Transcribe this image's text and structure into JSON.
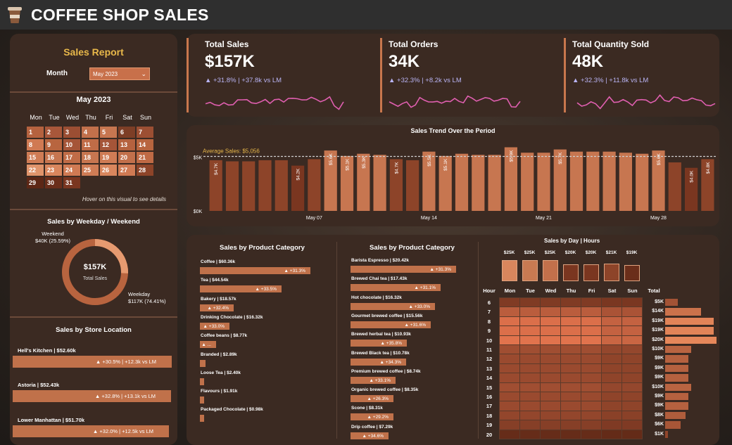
{
  "header": {
    "title": "COFFEE SHOP SALES",
    "icon": "coffee-cup-icon"
  },
  "colors": {
    "accent": "#c8774d",
    "gold": "#e8b84a",
    "panel": "#3b2a22",
    "sparkline": "#e05fb0",
    "change": "#b9b4f4"
  },
  "filters": {
    "title": "Sales Report",
    "month_label": "Month",
    "month_value": "May 2023"
  },
  "calendar": {
    "title": "May 2023",
    "weekdays": [
      "Mon",
      "Tue",
      "Wed",
      "Thu",
      "Fri",
      "Sat",
      "Sun"
    ],
    "days": [
      "1",
      "2",
      "3",
      "4",
      "5",
      "6",
      "7",
      "8",
      "9",
      "10",
      "11",
      "12",
      "13",
      "14",
      "15",
      "16",
      "17",
      "18",
      "19",
      "20",
      "21",
      "22",
      "23",
      "24",
      "25",
      "26",
      "27",
      "28",
      "29",
      "30",
      "31"
    ],
    "hint": "Hover on this visual to see details"
  },
  "weekday_split": {
    "title": "Sales by Weekday / Weekend",
    "total_value": "$157K",
    "total_label": "Total Sales",
    "weekend_label": "Weekend",
    "weekend_value": "$40K (25.59%)",
    "weekend_fraction": 0.2559,
    "weekday_label": "Weekday",
    "weekday_value": "$117K (74.41%)"
  },
  "stores": {
    "title": "Sales by Store Location",
    "items": [
      {
        "name": "Hell's Kitchen | $52.60k",
        "change": "▲ +30.5% | +12.3k vs LM",
        "fraction": 1.0
      },
      {
        "name": "Astoria | $52.43k",
        "change": "▲ +32.8% | +13.1k vs LM",
        "fraction": 0.997
      },
      {
        "name": "Lower Manhattan | $51.70k",
        "change": "▲ +32.0% | +12.5k vs LM",
        "fraction": 0.983
      }
    ]
  },
  "kpis": [
    {
      "title": "Total Sales",
      "value": "$157K",
      "change": "▲ +31.8% | +37.8k vs LM"
    },
    {
      "title": "Total Orders",
      "value": "34K",
      "change": "▲ +32.3% | +8.2k vs LM"
    },
    {
      "title": "Total Quantity Sold",
      "value": "48K",
      "change": "▲ +32.3% | +11.8k vs LM"
    }
  ],
  "trend": {
    "title": "Sales Trend Over the Period",
    "avg_label": "Average Sales: $5,056",
    "y_ticks": [
      "$5K",
      "$0K"
    ],
    "x_labels": [
      "May 07",
      "May 14",
      "May 21",
      "May 28"
    ]
  },
  "chart_data": [
    {
      "type": "bar",
      "title": "Sales Trend Over the Period",
      "x": [
        "1",
        "2",
        "3",
        "4",
        "5",
        "6",
        "7",
        "8",
        "9",
        "10",
        "11",
        "12",
        "13",
        "14",
        "15",
        "16",
        "17",
        "18",
        "19",
        "20",
        "21",
        "22",
        "23",
        "24",
        "25",
        "26",
        "27",
        "28",
        "29",
        "30",
        "31"
      ],
      "values": [
        4.7,
        4.6,
        4.6,
        4.7,
        4.7,
        4.2,
        4.8,
        5.6,
        5.1,
        5.3,
        5.2,
        4.8,
        4.7,
        5.5,
        5.1,
        5.3,
        5.2,
        5.2,
        5.9,
        5.4,
        5.4,
        5.7,
        5.5,
        5.5,
        5.5,
        5.4,
        5.3,
        5.6,
        4.5,
        4.0,
        4.8
      ],
      "labels": [
        "$4.7K",
        "",
        "",
        "",
        "",
        "$4.2K",
        "",
        "$5.6K",
        "$5.1K",
        "$5.3K",
        "",
        "$4.7K",
        "",
        "$5.5K",
        "$5.1K",
        "",
        "",
        "",
        "$5.9K",
        "",
        "",
        "$5.7K",
        "",
        "",
        "",
        "",
        "",
        "$5.6K",
        "",
        "$4.0K",
        "$4.8K",
        "$4.7K"
      ],
      "average": 5.056,
      "ylim": [
        0,
        6
      ]
    },
    {
      "type": "bar",
      "title": "Sales by Product Category",
      "categories": [
        "Coffee",
        "Tea",
        "Bakery",
        "Drinking Chocolate",
        "Coffee beans",
        "Branded",
        "Loose Tea",
        "Flavours",
        "Packaged Chocolate"
      ],
      "values": [
        60.36,
        44.54,
        18.57,
        16.32,
        8.77,
        2.89,
        2.4,
        1.91,
        0.98
      ],
      "labels": [
        "Coffee | $60.36k",
        "Tea | $44.54k",
        "Bakery | $18.57k",
        "Drinking Chocolate | $16.32k",
        "Coffee beans | $8.77k",
        "Branded | $2.89k",
        "Loose Tea | $2.40k",
        "Flavours | $1.91k",
        "Packaged Chocolate | $0.98k"
      ],
      "changes": [
        "▲ +31.3%",
        "▲ +33.5%",
        "▲ +32.4%",
        "▲ +33.0%",
        "▲ ...",
        "",
        "",
        "",
        ""
      ]
    },
    {
      "type": "bar",
      "title": "Sales by Product Category",
      "categories": [
        "Barista Espresso",
        "Brewed Chai tea",
        "Hot chocolate",
        "Gourmet brewed coffee",
        "Brewed herbal tea",
        "Brewed Black tea",
        "Premium brewed coffee",
        "Organic brewed coffee",
        "Scone",
        "Drip coffee"
      ],
      "values": [
        20.42,
        17.43,
        16.32,
        15.56,
        10.93,
        10.78,
        8.74,
        8.35,
        8.31,
        7.29
      ],
      "labels": [
        "Barista Espresso | $20.42k",
        "Brewed Chai tea | $17.43k",
        "Hot chocolate | $16.32k",
        "Gourmet brewed coffee | $15.56k",
        "Brewed herbal tea | $10.93k",
        "Brewed Black tea | $10.78k",
        "Premium brewed coffee | $8.74k",
        "Organic brewed coffee | $8.35k",
        "Scone | $8.31k",
        "Drip coffee | $7.29k"
      ],
      "changes": [
        "▲ +31.3%",
        "▲ +31.1%",
        "▲ +33.0%",
        "▲ +31.6%",
        "▲ +35.8%",
        "▲ +34.3%",
        "▲ +33.1%",
        "▲ +26.3%",
        "▲ +29.2%",
        "▲ +34.6%"
      ]
    },
    {
      "type": "heatmap",
      "title": "Sales by Day | Hours",
      "days": [
        "Mon",
        "Tue",
        "Wed",
        "Thu",
        "Fri",
        "Sat",
        "Sun"
      ],
      "day_totals": [
        "$25K",
        "$25K",
        "$25K",
        "$20K",
        "$20K",
        "$21K",
        "$19K"
      ],
      "day_values": [
        25,
        25,
        25,
        20,
        20,
        21,
        19
      ],
      "hours": [
        "6",
        "7",
        "8",
        "9",
        "10",
        "11",
        "12",
        "13",
        "14",
        "15",
        "16",
        "17",
        "18",
        "19",
        "20"
      ],
      "hour_totals": [
        "$5K",
        "$14K",
        "$19K",
        "$19K",
        "$20K",
        "$10K",
        "$9K",
        "$9K",
        "$9K",
        "$10K",
        "$9K",
        "$9K",
        "$8K",
        "$6K",
        "$1K"
      ],
      "hour_values": [
        5,
        14,
        19,
        19,
        20,
        10,
        9,
        9,
        9,
        10,
        9,
        9,
        8,
        6,
        1
      ],
      "hour_label": "Hour",
      "total_label": "Total"
    }
  ]
}
